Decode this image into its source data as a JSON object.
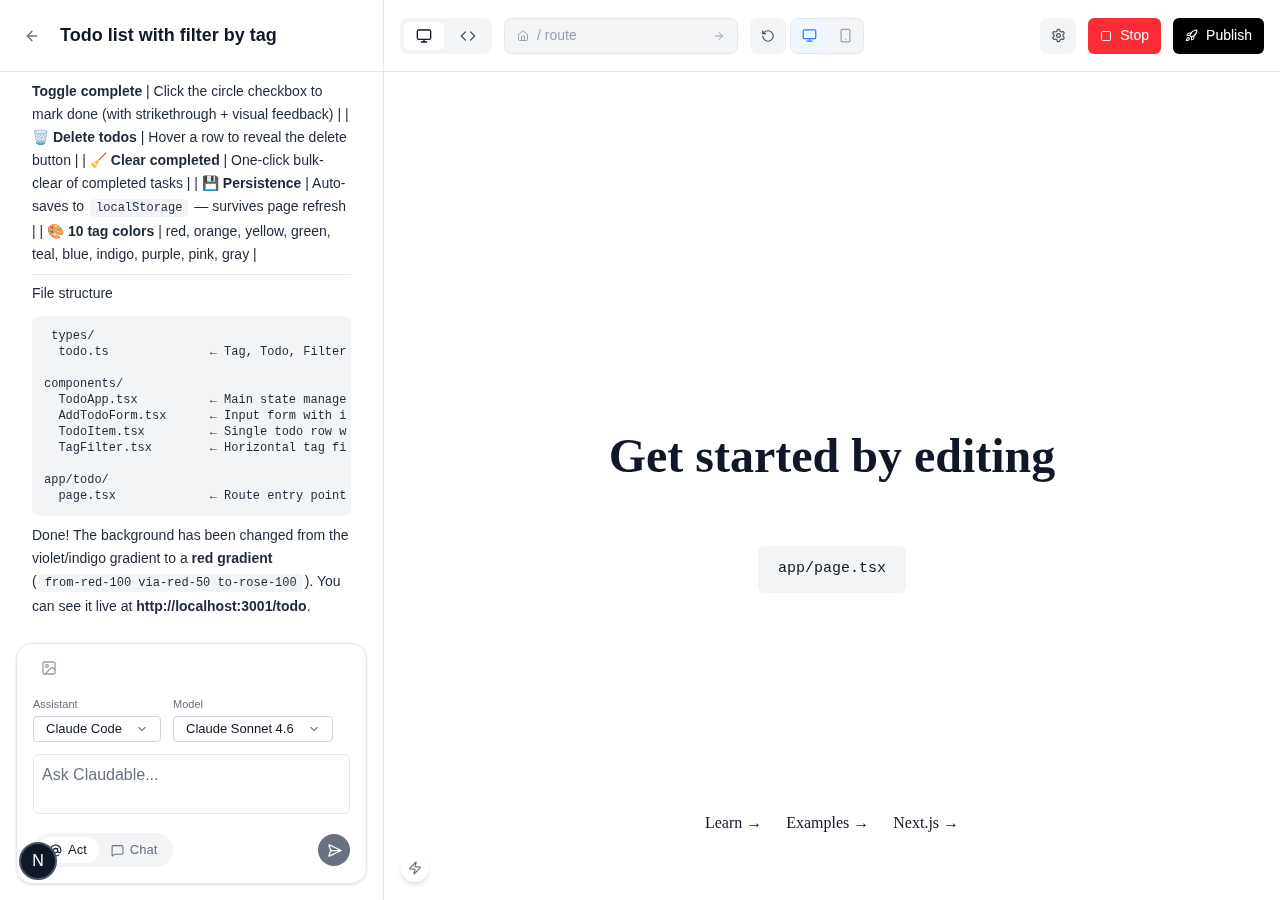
{
  "header": {
    "title": "Todo list with filter by tag"
  },
  "chat": {
    "feature_text": [
      {
        "kind": "text",
        "text": "**Toggle complete** | Click the circle checkbox to mark done (with strikethrough + visual feedback) | | 🗑️ **Delete todos** | Hover a row to reveal the delete button | | 🧹 **Clear completed** | One-click bulk-clear of completed tasks | | 💾 **Persistence** | Auto-saves to "
      },
      {
        "kind": "code",
        "text": "localStorage"
      },
      {
        "kind": "text",
        "text": " — survives page refresh | | 🎨 **10 tag colors** | red, orange, yellow, green, teal, blue, indigo, purple, pink, gray |"
      }
    ],
    "section_title": "File structure",
    "code_groups": [
      [
        " types/",
        "  todo.ts              ← Tag, Todo, Filter"
      ],
      [
        "components/",
        "  TodoApp.tsx          ← Main state manage",
        "  AddTodoForm.tsx      ← Input form with i",
        "  TodoItem.tsx         ← Single todo row w",
        "  TagFilter.tsx        ← Horizontal tag fi"
      ],
      [
        "app/todo/",
        "  page.tsx             ← Route entry point"
      ]
    ],
    "done_text": [
      {
        "kind": "text",
        "text": "Done! The background has been changed from the violet/indigo gradient to a **red gradient** ("
      },
      {
        "kind": "code",
        "text": "from-red-100 via-red-50 to-rose-100"
      },
      {
        "kind": "text",
        "text": "). You can see it live at **http://localhost:3001/todo**."
      }
    ]
  },
  "composer": {
    "assistant_label": "Assistant",
    "assistant_value": "Claude Code",
    "model_label": "Model",
    "model_value": "Claude Sonnet 4.6",
    "placeholder": "Ask Claudable...",
    "modes": [
      {
        "kind": "act",
        "label": "Act",
        "selected": true
      },
      {
        "kind": "chat",
        "label": "Chat",
        "selected": false
      }
    ]
  },
  "dev_badge": "N",
  "toolbar": {
    "views": [
      {
        "kind": "preview",
        "selected": true
      },
      {
        "kind": "code",
        "selected": false
      }
    ],
    "route": "/ route",
    "devices": [
      {
        "kind": "desktop",
        "selected": true
      },
      {
        "kind": "mobile",
        "selected": false
      }
    ],
    "stop": "Stop",
    "publish": "Publish"
  },
  "preview": {
    "heading": "Get started by editing",
    "file": "app/page.tsx",
    "links": [
      "Learn →",
      "Examples →",
      "Next.js →"
    ]
  }
}
